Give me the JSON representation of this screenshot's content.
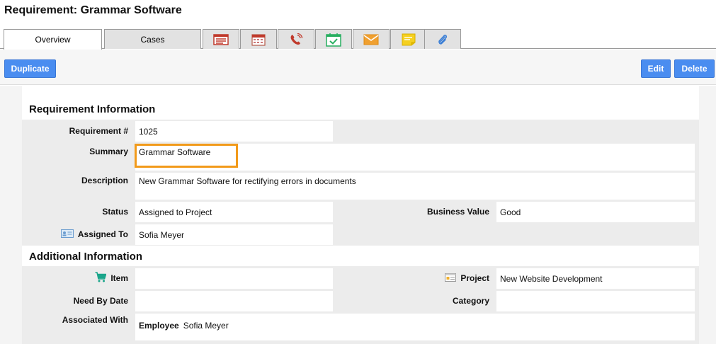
{
  "page": {
    "title": "Requirement: Grammar Software"
  },
  "tabs": {
    "overview": "Overview",
    "cases": "Cases",
    "icons": [
      "list-icon",
      "calendar-icon",
      "phone-icon",
      "task-icon",
      "email-icon",
      "note-icon",
      "attachment-icon"
    ]
  },
  "toolbar": {
    "duplicate": "Duplicate",
    "edit": "Edit",
    "delete": "Delete"
  },
  "requirement_info": {
    "title": "Requirement Information",
    "requirement_no_label": "Requirement #",
    "requirement_no": "1025",
    "summary_label": "Summary",
    "summary": "Grammar Software",
    "description_label": "Description",
    "description": "New Grammar Software for rectifying errors in documents",
    "status_label": "Status",
    "status": "Assigned to Project",
    "business_value_label": "Business Value",
    "business_value": "Good",
    "assigned_to_label": "Assigned To",
    "assigned_to": "Sofia Meyer"
  },
  "additional_info": {
    "title": "Additional Information",
    "item_label": "Item",
    "item": "",
    "project_label": "Project",
    "project": "New Website Development",
    "need_by_date_label": "Need By Date",
    "need_by_date": "",
    "category_label": "Category",
    "category": "",
    "associated_with_label": "Associated With",
    "associated_type": "Employee",
    "associated_name": "Sofia Meyer"
  },
  "colors": {
    "accent": "#4a8df0",
    "highlight": "#f29a1a",
    "tab_bg": "#e2e2e2",
    "grid_bg": "#ececec"
  }
}
